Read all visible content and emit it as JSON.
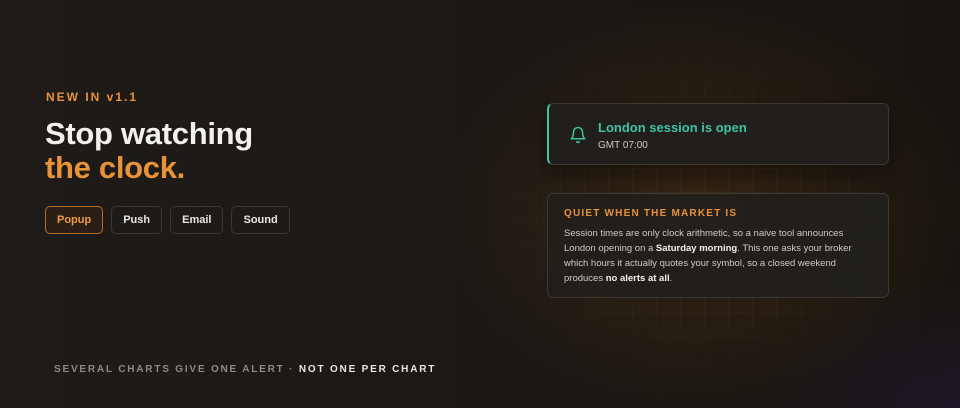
{
  "hero": {
    "eyebrow": "NEW IN v1.1",
    "headline_line1": "Stop watching",
    "headline_line2": "the clock."
  },
  "channels": [
    {
      "label": "Popup",
      "active": true
    },
    {
      "label": "Push",
      "active": false
    },
    {
      "label": "Email",
      "active": false
    },
    {
      "label": "Sound",
      "active": false
    }
  ],
  "footer": {
    "lead": "SEVERAL CHARTS GIVE ONE ALERT",
    "separator": "·",
    "emphasis": "NOT ONE PER CHART"
  },
  "notification": {
    "icon": "bell-icon",
    "title": "London session is open",
    "subtitle": "GMT 07:00",
    "accent_color": "#3dc4a0"
  },
  "info_card": {
    "heading": "QUIET WHEN THE MARKET IS",
    "text_1": "Session times are only clock arithmetic, so a naive tool announces London opening on a ",
    "bold_1": "Saturday morning",
    "text_2": ". This one asks your broker which hours it actually quotes your symbol, so a closed weekend produces ",
    "bold_2": "no alerts at all",
    "text_3": "."
  },
  "colors": {
    "accent": "#e8923a",
    "success": "#3dc4a0",
    "background": "#1b1816"
  }
}
